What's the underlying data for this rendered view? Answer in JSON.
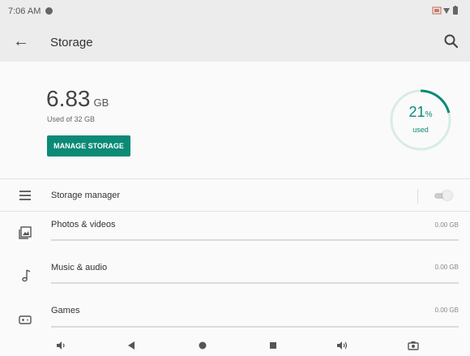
{
  "status_bar": {
    "time": "7:06 AM"
  },
  "app_bar": {
    "title": "Storage"
  },
  "summary": {
    "used_amount": "6.83",
    "used_unit": "GB",
    "used_of": "Used of 32 GB",
    "manage_button": "MANAGE STORAGE",
    "percent_value": "21",
    "percent_sign": "%",
    "percent_label": "used",
    "percent_fraction": 0.21
  },
  "storage_manager": {
    "label": "Storage manager",
    "enabled": false
  },
  "categories": [
    {
      "label": "Photos & videos",
      "size": "0.00 GB",
      "icon": "photo-icon"
    },
    {
      "label": "Music & audio",
      "size": "0.00 GB",
      "icon": "music-note-icon"
    },
    {
      "label": "Games",
      "size": "0.00 GB",
      "icon": "gamepad-icon"
    }
  ],
  "colors": {
    "accent": "#0b8a76",
    "app_bar": "#ececec",
    "background": "#fafafa"
  }
}
